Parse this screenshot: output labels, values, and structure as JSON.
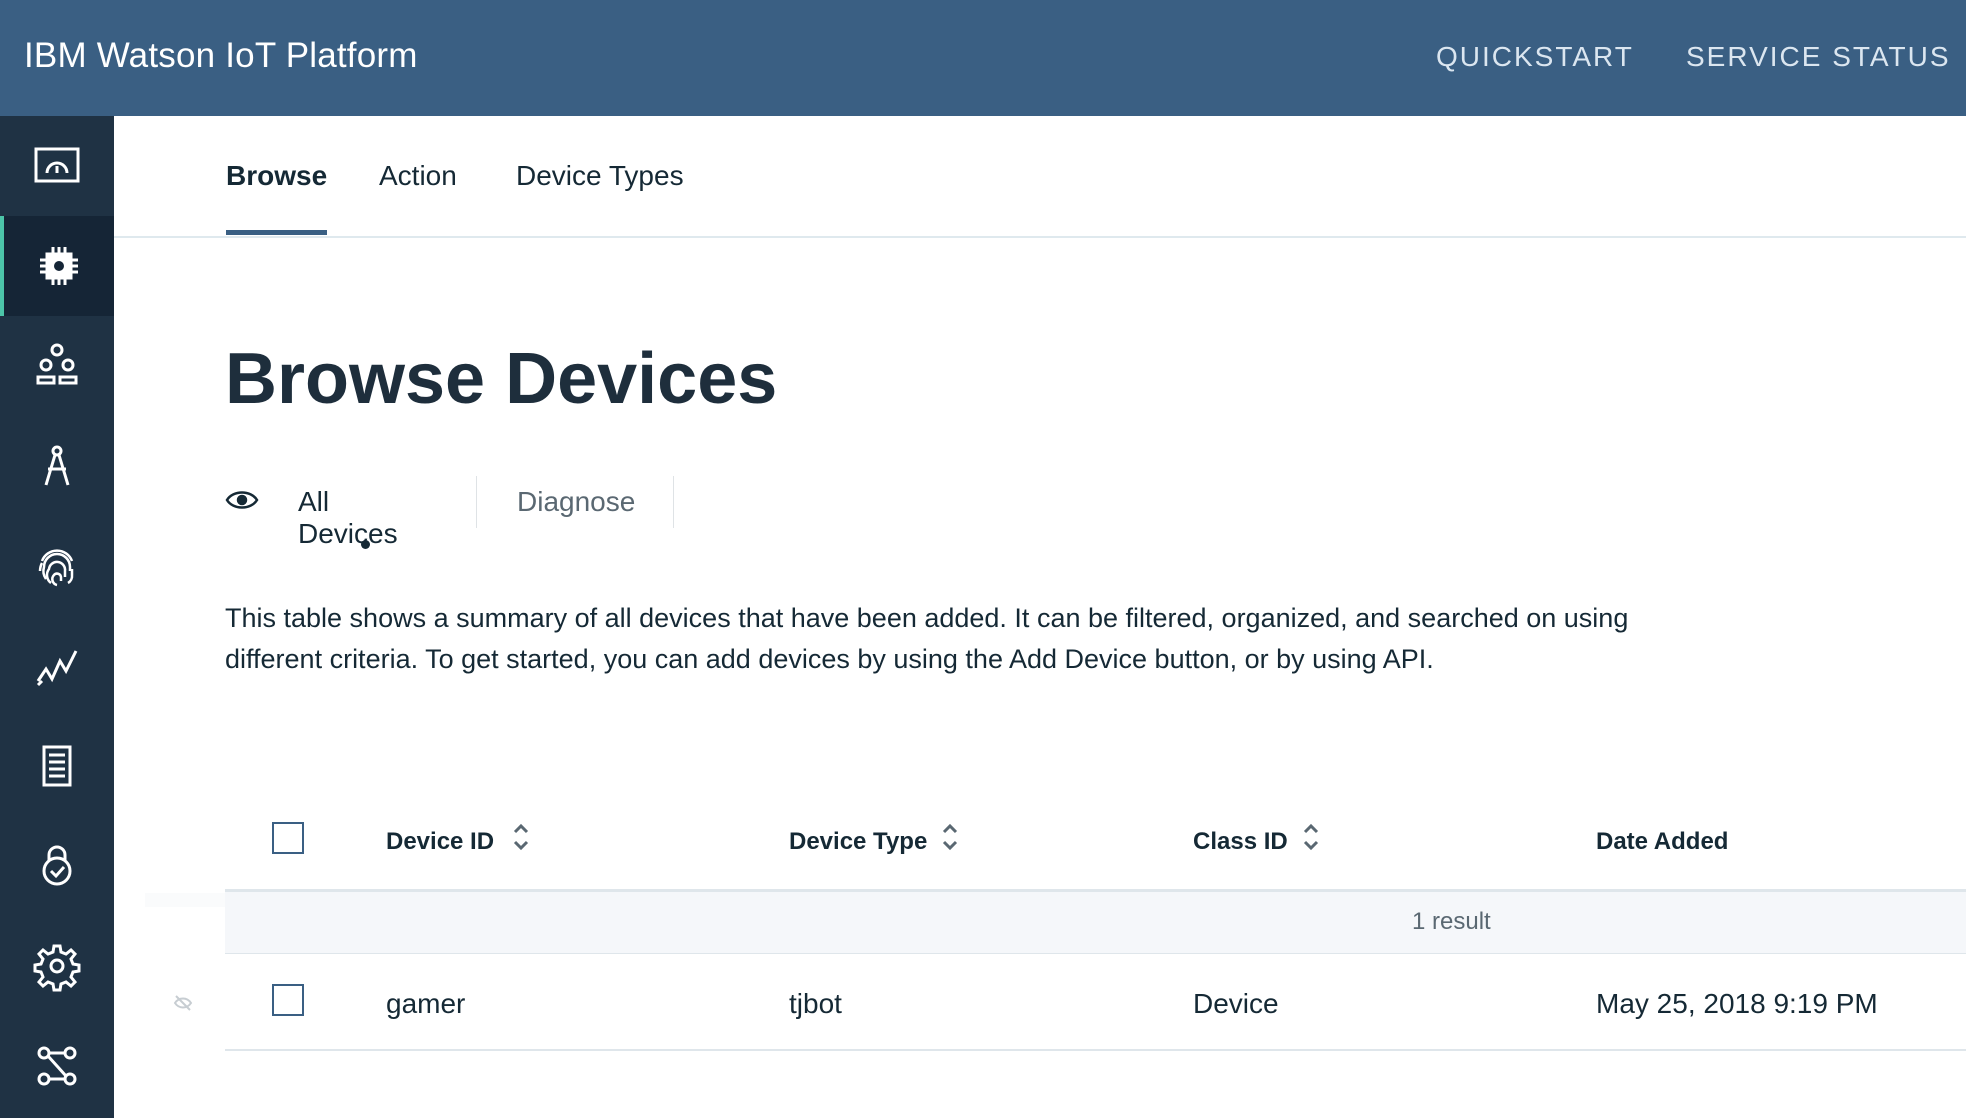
{
  "header": {
    "brand": "IBM Watson IoT Platform",
    "links": [
      "QUICKSTART",
      "SERVICE STATUS"
    ],
    "background": "#3a5f83"
  },
  "sidebar": {
    "background": "#1f3244",
    "accent": "#4cc5a9",
    "items": [
      {
        "icon": "dashboard-icon"
      },
      {
        "icon": "chip-icon",
        "active": true
      },
      {
        "icon": "members-icon"
      },
      {
        "icon": "compass-icon"
      },
      {
        "icon": "fingerprint-icon"
      },
      {
        "icon": "analytics-icon"
      },
      {
        "icon": "document-icon"
      },
      {
        "icon": "security-icon"
      },
      {
        "icon": "settings-icon"
      },
      {
        "icon": "extensions-icon"
      }
    ]
  },
  "tabs": [
    {
      "label": "Browse",
      "active": true
    },
    {
      "label": "Action"
    },
    {
      "label": "Device Types"
    }
  ],
  "page": {
    "title": "Browse Devices",
    "subtabs": [
      {
        "label": "All Devices",
        "active": true
      },
      {
        "label": "Diagnose"
      }
    ],
    "description": "This table shows a summary of all devices that have been added. It can be filtered, organized, and searched on using different criteria. To get started, you can add devices by using the Add Device button, or by using API."
  },
  "table": {
    "columns": [
      "Device ID",
      "Device Type",
      "Class ID",
      "Date Added"
    ],
    "result_count": "1 result",
    "rows": [
      {
        "device_id": "gamer",
        "device_type": "tjbot",
        "class_id": "Device",
        "date_added": "May 25, 2018 9:19 PM"
      }
    ]
  }
}
